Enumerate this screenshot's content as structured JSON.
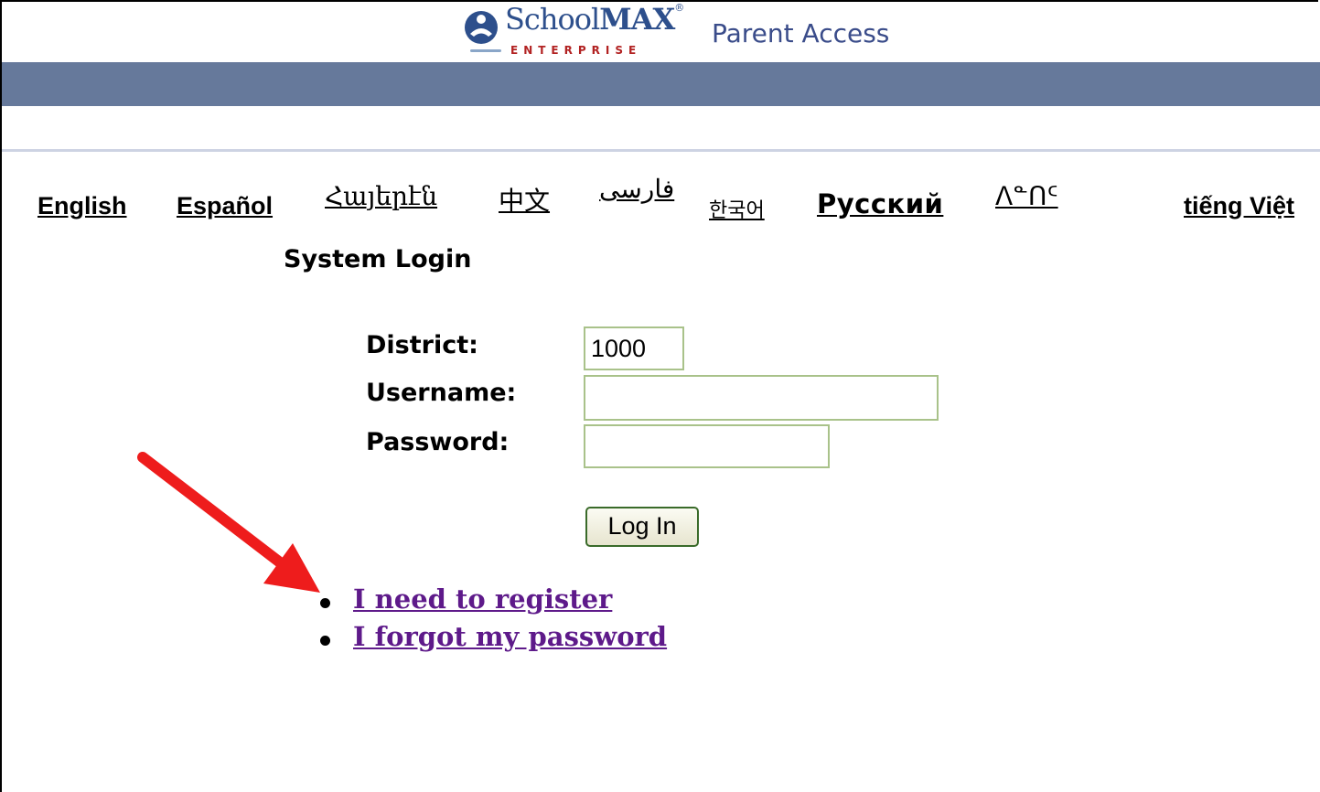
{
  "header": {
    "logo_school": "School",
    "logo_max": "MAX",
    "logo_tm": "®",
    "logo_enterprise": "ENTERPRISE",
    "app_title": "Parent Access",
    "banner_color": "#66799b"
  },
  "languages": [
    {
      "label": "English"
    },
    {
      "label": "Español"
    },
    {
      "label": "Հայերէն"
    },
    {
      "label": "中文"
    },
    {
      "label": "فارسی"
    },
    {
      "label": "한국어"
    },
    {
      "label": "Русский"
    },
    {
      "label": "ᐱᓐᑎᑦ"
    },
    {
      "label": "tiếng Việt"
    }
  ],
  "login": {
    "title": "System Login",
    "district_label": "District:",
    "district_value": "1000",
    "username_label": "Username:",
    "username_value": "",
    "password_label": "Password:",
    "password_value": "",
    "submit_label": "Log In"
  },
  "links": {
    "register": "I need to register",
    "forgot": "I forgot my password"
  },
  "annotation": {
    "arrow_color": "#ee1c1c"
  }
}
